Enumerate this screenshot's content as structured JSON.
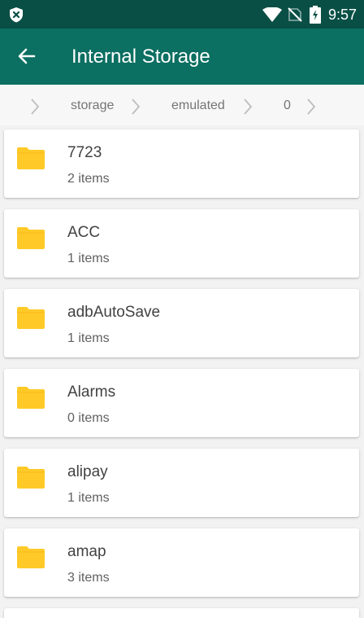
{
  "status_bar": {
    "time": "9:57",
    "left_icon": "shield-x-icon",
    "right_icons": [
      "wifi-icon",
      "no-sim-icon",
      "battery-charging-icon"
    ]
  },
  "app_bar": {
    "title": "Internal Storage",
    "back_icon": "arrow-left-icon"
  },
  "breadcrumb": {
    "segments": [
      "storage",
      "emulated",
      "0"
    ],
    "separator_icon": "chevron-right-icon"
  },
  "folders": [
    {
      "name": "7723",
      "count": "2 items"
    },
    {
      "name": "ACC",
      "count": "1 items"
    },
    {
      "name": "adbAutoSave",
      "count": "1 items"
    },
    {
      "name": "Alarms",
      "count": "0 items"
    },
    {
      "name": "alipay",
      "count": "1 items"
    },
    {
      "name": "amap",
      "count": "3 items"
    }
  ],
  "colors": {
    "status_bar": "#094f45",
    "app_bar": "#0b6f61",
    "folder_icon": "#ffca28",
    "background": "#f2f2f2"
  }
}
